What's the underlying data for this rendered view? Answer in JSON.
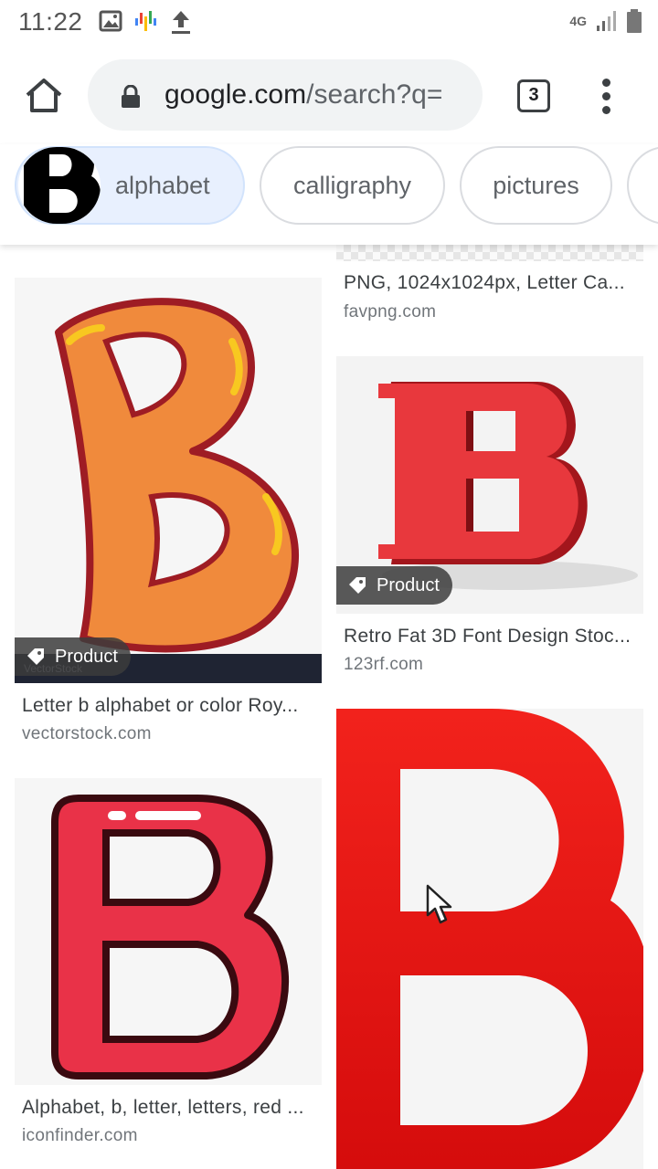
{
  "status_bar": {
    "time": "11:22",
    "network": "4G",
    "icons": [
      "image-icon",
      "assistant-icon",
      "upload-icon",
      "signal-icon",
      "battery-icon"
    ]
  },
  "browser": {
    "url_host": "google.com",
    "url_rest": "/search?q=",
    "tab_count": "3"
  },
  "chips": [
    {
      "label": "alphabet",
      "active": true
    },
    {
      "label": "calligraphy",
      "active": false
    },
    {
      "label": "pictures",
      "active": false
    }
  ],
  "results": [
    {
      "title": "PNG, 1024x1024px, Letter Ca...",
      "source": "favpng.com"
    },
    {
      "title": "Letter b alphabet or color Roy...",
      "source": "vectorstock.com",
      "badge": "Product"
    },
    {
      "title": "Retro Fat 3D Font Design Stoc...",
      "source": "123rf.com",
      "badge": "Product"
    },
    {
      "title": "Alphabet, b, letter, letters, red ...",
      "source": "iconfinder.com"
    }
  ],
  "colors": {
    "chip_active_bg": "#e8f0fe",
    "badge_bg": "#3c3c3c",
    "red_letter": "#e8383d",
    "orange_letter": "#f08a3c"
  }
}
